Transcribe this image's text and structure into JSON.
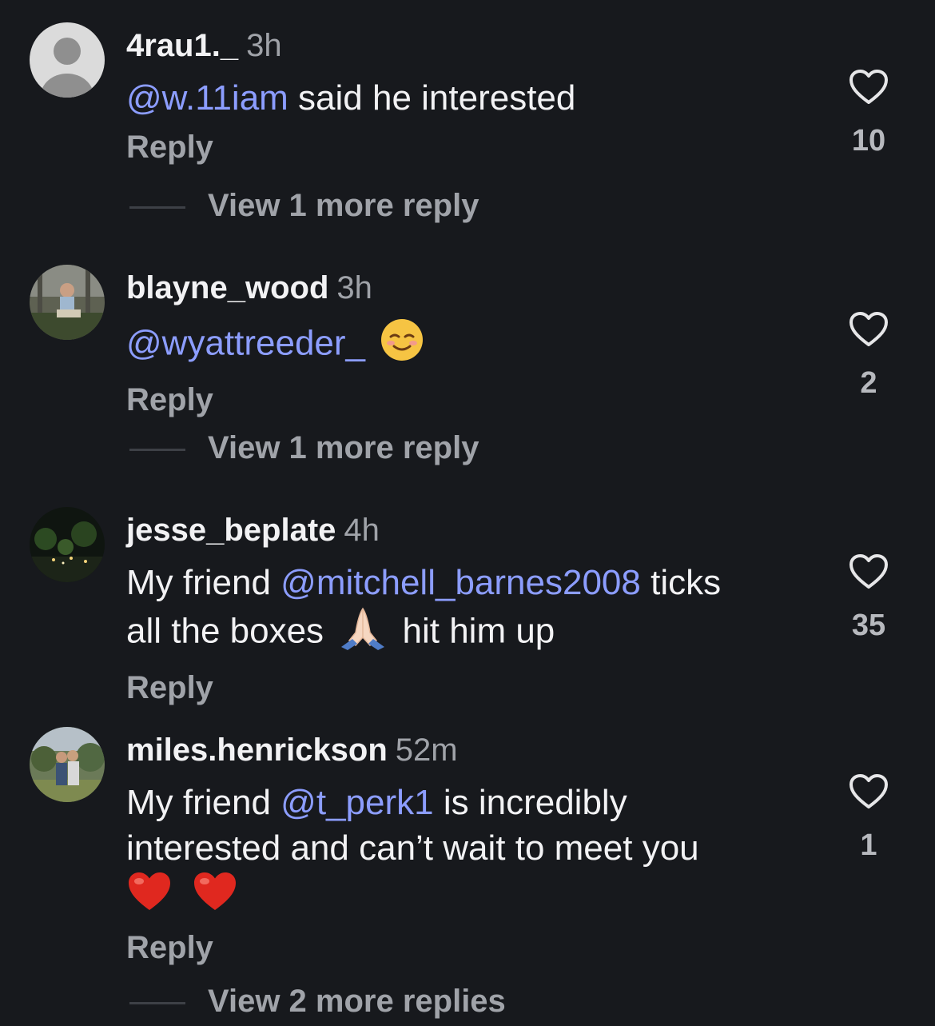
{
  "comments": [
    {
      "username": "4rau1._",
      "time": "3h",
      "mention": "@w.11iam",
      "text": " said he interested",
      "reply_label": "Reply",
      "likes": "10",
      "more_replies": "View 1 more reply",
      "avatar": "default-avatar-icon"
    },
    {
      "username": "blayne_wood",
      "time": "3h",
      "mention": "@wyattreeder_",
      "emoji": "smiling-face-icon",
      "reply_label": "Reply",
      "likes": "2",
      "more_replies": "View 1 more reply",
      "avatar": "user-photo"
    },
    {
      "username": "jesse_beplate",
      "time": "4h",
      "text_before": "My friend ",
      "mention": "@mitchell_barnes2008",
      "text_after": " ticks",
      "text_line2_a": "all the boxes ",
      "text_line2_b": " hit him up",
      "emoji": "folded-hands-icon",
      "reply_label": "Reply",
      "likes": "35",
      "avatar": "user-photo"
    },
    {
      "username": "miles.henrickson",
      "time": "52m",
      "text_before": "My friend ",
      "mention": "@t_perk1",
      "text_after": " is incredibly",
      "text_line2": "interested and can’t wait to meet you",
      "emoji": "red-heart-icon",
      "reply_label": "Reply",
      "likes": "1",
      "more_replies": "View 2 more replies",
      "avatar": "user-photo"
    }
  ],
  "colors": {
    "background": "#17191d",
    "mention": "#8c9dff",
    "secondary_text": "#a0a3a9"
  }
}
